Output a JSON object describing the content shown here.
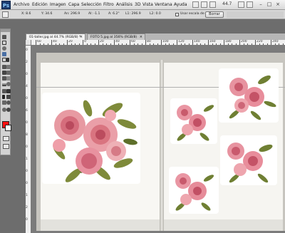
{
  "app": {
    "logo_text": "Ps"
  },
  "menu": [
    "Archivo",
    "Edición",
    "Imagen",
    "Capa",
    "Selección",
    "Filtro",
    "Análisis",
    "3D",
    "Vista",
    "Ventana",
    "Ayuda"
  ],
  "zoom": "44.7",
  "options_bar": {
    "x": "X: 8.6",
    "y": "Y: 34.6",
    "w": "An: 296.9",
    "h": "Al: -1.1",
    "a": "A: 6.2°",
    "l1": "L1: 296.9",
    "l2": "L2: 0.0",
    "checkbox_label": "Usar escala de medida",
    "button_label": "Borrar"
  },
  "tabs": [
    {
      "label": "01-taller.jpg al 44.7% (RGB/8) *",
      "active": true
    },
    {
      "label": "FOTO 5.jpg al 356% (RGB/8)",
      "active": false
    }
  ],
  "colors": {
    "foreground": "#ff1111",
    "background": "#ffffff"
  },
  "ruler_top": [
    "60",
    "40",
    "20",
    "0",
    "20",
    "40",
    "60",
    "80",
    "100",
    "120",
    "140",
    "160",
    "180",
    "200",
    "220",
    "240"
  ],
  "ruler_left": [
    "0",
    "2",
    "0",
    "4",
    "0",
    "6",
    "0",
    "8",
    "0",
    "1",
    "0",
    "0",
    "1",
    "2",
    "0"
  ],
  "canvas": {
    "content": "scanned-book-page-with-rose-illustrations"
  }
}
